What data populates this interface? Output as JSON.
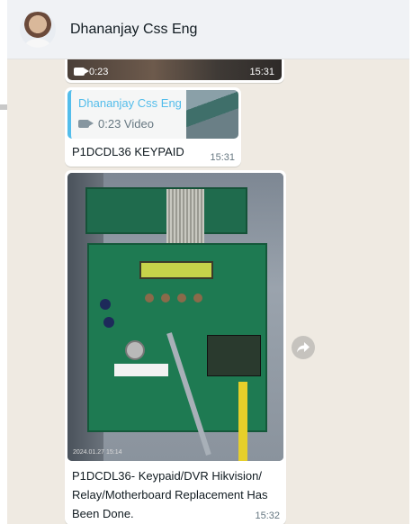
{
  "header": {
    "contact_name": "Dhananjay Css Eng",
    "avatar_icon": "avatar-icon"
  },
  "messages": [
    {
      "type": "video",
      "duration": "0:23",
      "time": "15:31"
    },
    {
      "type": "reply",
      "quote": {
        "author": "Dhananjay Css Eng",
        "media_label": "0:23 Video"
      },
      "text": "P1DCDL36 KEYPAID",
      "time": "15:31"
    },
    {
      "type": "image",
      "photo_stamp": "2024.01.27 15:14",
      "caption": "P1DCDL36- Keypaid/DVR Hikvision/ Relay/Motherboard Replacement Has Been Done.",
      "time": "15:32"
    }
  ],
  "colors": {
    "chat_background": "#efeae2",
    "header_background": "#f0f2f5",
    "quote_accent": "#53bdeb",
    "bubble": "#ffffff"
  },
  "icons": {
    "forward": "forward-icon",
    "video": "video-camera-icon"
  }
}
